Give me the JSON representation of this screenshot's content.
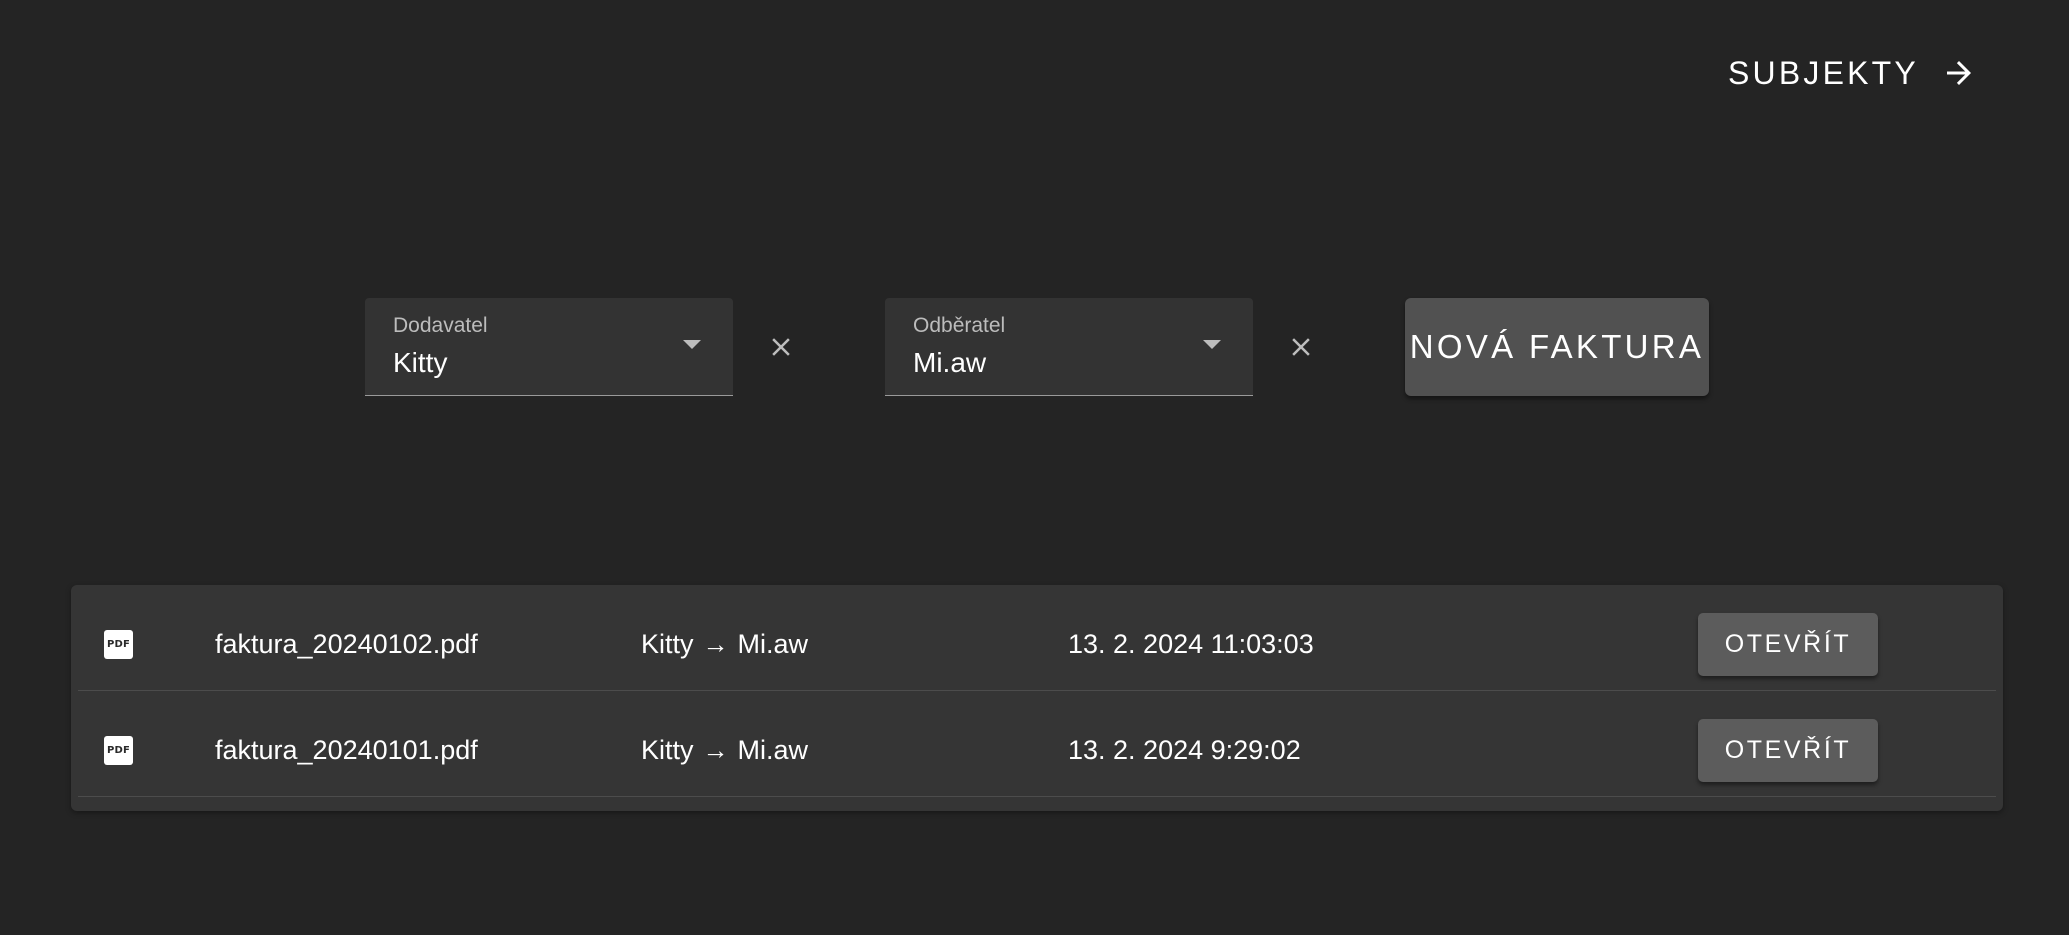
{
  "nav": {
    "subjects_label": "SUBJEKTY",
    "subjects_icon": "arrow-right-icon"
  },
  "filters": {
    "supplier": {
      "label": "Dodavatel",
      "value": "Kitty",
      "clear_icon": "close-icon"
    },
    "customer": {
      "label": "Odběratel",
      "value": "Mi.aw",
      "clear_icon": "close-icon"
    },
    "new_invoice_label": "NOVÁ FAKTURA"
  },
  "invoices": [
    {
      "icon": "pdf-icon",
      "icon_text": "PDF",
      "file_name": "faktura_20240102.pdf",
      "supplier": "Kitty",
      "arrow": "→",
      "customer": "Mi.aw",
      "created": "13. 2. 2024 11:03:03",
      "open_label": "OTEVŘÍT"
    },
    {
      "icon": "pdf-icon",
      "icon_text": "PDF",
      "file_name": "faktura_20240101.pdf",
      "supplier": "Kitty",
      "arrow": "→",
      "customer": "Mi.aw",
      "created": "13. 2. 2024 9:29:02",
      "open_label": "OTEVŘÍT"
    }
  ],
  "colors": {
    "background": "#242424",
    "surface": "#333333",
    "card": "#353535",
    "button": "#515151",
    "button_secondary": "#5c5c5c",
    "text": "#ffffff",
    "label": "#bcbcbc"
  }
}
